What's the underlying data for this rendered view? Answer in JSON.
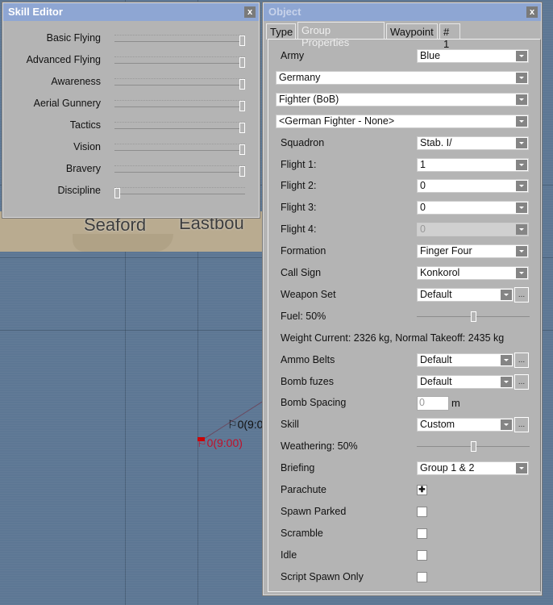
{
  "map": {
    "towns": [
      "Seaford",
      "Eastbou"
    ],
    "markers": [
      "0(9:0",
      "0(9:00)"
    ]
  },
  "skill_editor": {
    "title": "Skill Editor",
    "close": "x",
    "skills": [
      {
        "label": "Basic Flying",
        "value": 1.0
      },
      {
        "label": "Advanced Flying",
        "value": 1.0
      },
      {
        "label": "Awareness",
        "value": 1.0
      },
      {
        "label": "Aerial Gunnery",
        "value": 1.0
      },
      {
        "label": "Tactics",
        "value": 1.0
      },
      {
        "label": "Vision",
        "value": 1.0
      },
      {
        "label": "Bravery",
        "value": 1.0
      },
      {
        "label": "Discipline",
        "value": 0.0
      }
    ]
  },
  "object": {
    "title": "Object",
    "close": "x",
    "tabs": [
      "Type",
      "Group Properties",
      "Waypoint",
      "# 1"
    ],
    "active_tab": 1,
    "rows": [
      {
        "kind": "select",
        "label": "Army",
        "value": "Blue"
      },
      {
        "kind": "full",
        "value": "Germany"
      },
      {
        "kind": "full",
        "value": "Fighter (BoB)"
      },
      {
        "kind": "full",
        "value": "<German Fighter - None>"
      },
      {
        "kind": "select",
        "label": "Squadron",
        "value": "Stab. I/"
      },
      {
        "kind": "select",
        "label": "Flight 1:",
        "value": "1"
      },
      {
        "kind": "select",
        "label": "Flight 2:",
        "value": "0"
      },
      {
        "kind": "select",
        "label": "Flight 3:",
        "value": "0"
      },
      {
        "kind": "disabled",
        "label": "Flight 4:",
        "value": "0"
      },
      {
        "kind": "select",
        "label": "Formation",
        "value": "Finger Four"
      },
      {
        "kind": "select",
        "label": "Call Sign",
        "value": "Konkorol"
      },
      {
        "kind": "selectbtn",
        "label": "Weapon Set",
        "value": "Default",
        "button": "..."
      },
      {
        "kind": "slider",
        "label": "Fuel: 50%",
        "value": 0.5
      },
      {
        "kind": "text",
        "label": "Weight  Current: 2326 kg, Normal Takeoff: 2435 kg"
      },
      {
        "kind": "selectbtn",
        "label": "Ammo Belts",
        "value": "Default",
        "button": "..."
      },
      {
        "kind": "selectbtn",
        "label": "Bomb fuzes",
        "value": "Default",
        "button": "..."
      },
      {
        "kind": "input",
        "label": "Bomb Spacing",
        "value": "0",
        "unit": "m"
      },
      {
        "kind": "selectbtn",
        "label": "Skill",
        "value": "Custom",
        "button": "..."
      },
      {
        "kind": "slider",
        "label": "Weathering: 50%",
        "value": 0.5
      },
      {
        "kind": "select",
        "label": "Briefing",
        "value": "Group 1 & 2"
      },
      {
        "kind": "check",
        "label": "Parachute",
        "checked": true
      },
      {
        "kind": "check",
        "label": "Spawn Parked",
        "checked": false
      },
      {
        "kind": "check",
        "label": "Scramble",
        "checked": false
      },
      {
        "kind": "check",
        "label": "Idle",
        "checked": false
      },
      {
        "kind": "check",
        "label": "Script Spawn Only",
        "checked": false
      }
    ]
  }
}
